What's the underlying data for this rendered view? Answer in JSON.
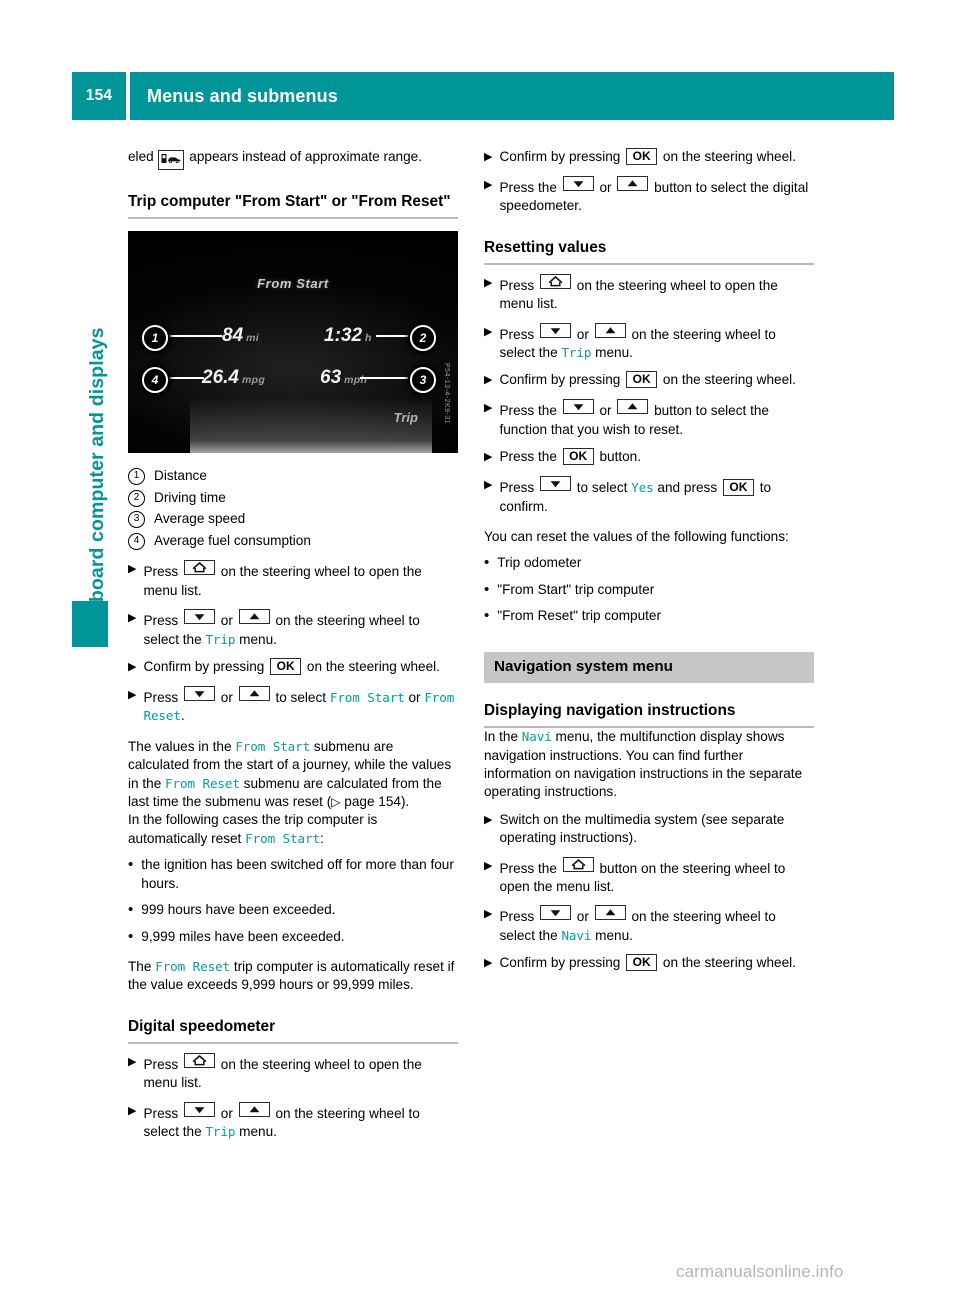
{
  "header": {
    "page_number": "154",
    "title": "Menus and submenus",
    "accent_color": "#009699"
  },
  "side_tab": {
    "label": "On-board computer and displays"
  },
  "watermark": "carmanualsonline.info",
  "icons": {
    "ok": "OK",
    "down": "down-arrow",
    "up": "up-arrow",
    "home": "home-menu",
    "step_marker": "▶",
    "bullet_marker": "•",
    "page_ref_marker": "▷"
  },
  "left_column": {
    "intro": {
      "before_icon": "eled",
      "icon_name": "car-refuel-icon",
      "after_icon": "appears instead of approximate range."
    },
    "heading_trip": "Trip computer \"From Start\" or \"From Reset\"",
    "figure": {
      "display_title": "From Start",
      "footer_label": "Trip",
      "side_code": "P54-13-4-2K9-31",
      "values": [
        {
          "callout": "1",
          "value": "84",
          "unit": "mi"
        },
        {
          "callout": "2",
          "value": "1:32",
          "unit": "h"
        },
        {
          "callout": "4",
          "value": "26.4",
          "unit": "mpg"
        },
        {
          "callout": "3",
          "value": "63",
          "unit": "mph"
        }
      ]
    },
    "legend": [
      {
        "num": "1",
        "label": "Distance"
      },
      {
        "num": "2",
        "label": "Driving time"
      },
      {
        "num": "3",
        "label": "Average speed"
      },
      {
        "num": "4",
        "label": "Average fuel consumption"
      }
    ],
    "steps_trip": {
      "s1_a": "Press",
      "s1_b": "on the steering wheel to open the menu list.",
      "s2_a": "Press",
      "s2_or": "or",
      "s2_b": "on the steering wheel to select the",
      "s2_menu": "Trip",
      "s2_c": "menu.",
      "s3_a": "Confirm by pressing",
      "s3_b": "on the steering wheel.",
      "s4_a": "Press",
      "s4_or": "or",
      "s4_b": "to select",
      "s4_menu1": "From Start",
      "s4_c": "or",
      "s4_menu2": "From Reset",
      "s4_d": "."
    },
    "para_values": {
      "p1": "The values in the",
      "menu1": "From Start",
      "p2": "submenu are calculated from the start of a journey, while the values in the",
      "menu2": "From Reset",
      "p3": "submenu are calculated from the last time the submenu was reset (",
      "page_ref": "page 154",
      "p4": ")."
    },
    "para_auto_reset": {
      "p1": "In the following cases the trip computer is automatically reset",
      "menu": "From Start",
      "p2": ":"
    },
    "bullets_auto_reset": [
      "the ignition has been switched off for more than four hours.",
      "999 hours have been exceeded.",
      "9,999 miles have been exceeded."
    ],
    "para_from_reset": {
      "p1": "The",
      "menu": "From Reset",
      "p2": "trip computer is automatically reset if the value exceeds 9,999 hours or 99,999 miles."
    },
    "heading_speedo": "Digital speedometer",
    "steps_speedo": {
      "s1_a": "Press",
      "s1_b": "on the steering wheel to open the menu list.",
      "s2_a": "Press",
      "s2_or": "or",
      "s2_b": "on the steering wheel to select the",
      "s2_menu": "Trip",
      "s2_c": "menu."
    }
  },
  "right_column": {
    "steps_speedo_cont": {
      "s1_a": "Confirm by pressing",
      "s1_b": "on the steering wheel.",
      "s2_a": "Press the",
      "s2_or": "or",
      "s2_b": "button to select the digital speedometer."
    },
    "heading_resetting": "Resetting values",
    "steps_resetting": {
      "s1_a": "Press",
      "s1_b": "on the steering wheel to open the menu list.",
      "s2_a": "Press",
      "s2_or": "or",
      "s2_b": "on the steering wheel to select the",
      "s2_menu": "Trip",
      "s2_c": "menu.",
      "s3_a": "Confirm by pressing",
      "s3_b": "on the steering wheel.",
      "s4_a": "Press the",
      "s4_or": "or",
      "s4_b": "button to select the function that you wish to reset.",
      "s5_a": "Press the",
      "s5_b": "button.",
      "s6_a": "Press",
      "s6_b": "to select",
      "s6_menu": "Yes",
      "s6_c": "and press",
      "s6_d": "to confirm."
    },
    "para_reset_list": "You can reset the values of the following functions:",
    "bullets_reset_list": [
      "Trip odometer",
      "\"From Start\" trip computer",
      "\"From Reset\" trip computer"
    ],
    "band_heading": "Navigation system menu",
    "heading_nav": "Displaying navigation instructions",
    "para_nav": {
      "p1": "In the",
      "menu": "Navi",
      "p2": "menu, the multifunction display shows navigation instructions. You can find further information on navigation instructions in the separate operating instructions."
    },
    "steps_nav": {
      "s1": "Switch on the multimedia system (see separate operating instructions).",
      "s2_a": "Press the",
      "s2_b": "button on the steering wheel to open the menu list.",
      "s3_a": "Press",
      "s3_or": "or",
      "s3_b": "on the steering wheel to select the",
      "s3_menu": "Navi",
      "s3_c": "menu.",
      "s4_a": "Confirm by pressing",
      "s4_b": "on the steering wheel."
    }
  }
}
